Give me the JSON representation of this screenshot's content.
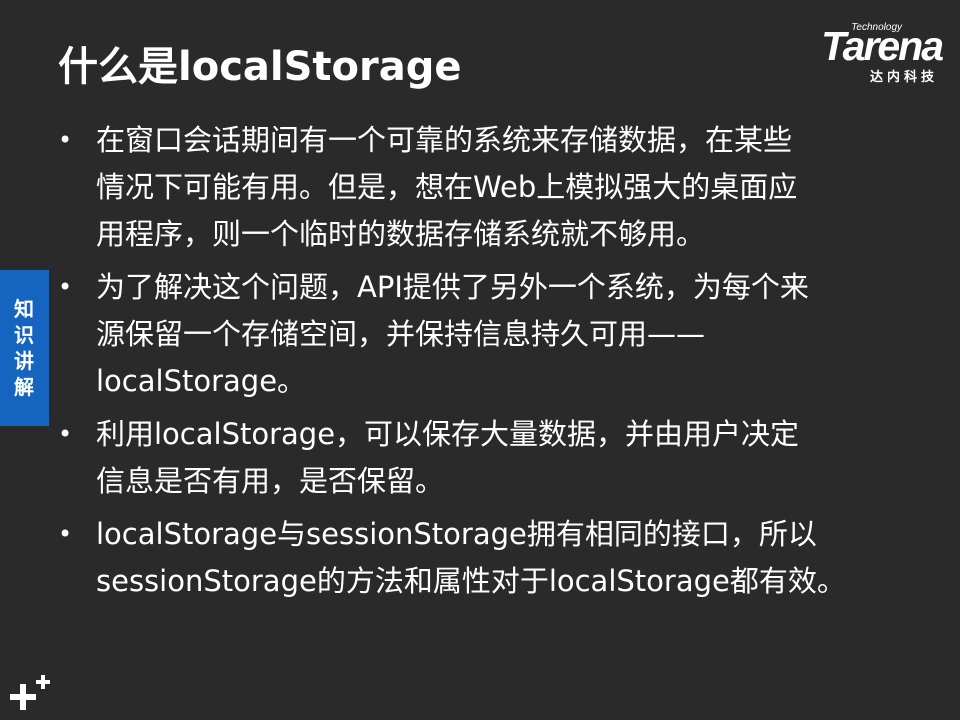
{
  "slide": {
    "title": "什么是localStorage",
    "logo": {
      "brand": "Tarena",
      "tagline": "Technology",
      "chinese": "达内科技"
    },
    "side_tab": {
      "label": "知识讲解"
    },
    "bullets": [
      {
        "lines": [
          "在窗口会话期间有一个可靠的系统来存储数据，在某些",
          "情况下可能有用。但是，想在Web上模拟强大的桌面应",
          "用程序，则一个临时的数据存储系统就不够用。"
        ]
      },
      {
        "lines": [
          "为了解决这个问题，API提供了另外一个系统，为每个来",
          "源保留一个存储空间，并保持信息持久可用——",
          "localStorage。"
        ]
      },
      {
        "lines": [
          "利用localStorage，可以保存大量数据，并由用户决定",
          "信息是否有用，是否保留。"
        ]
      },
      {
        "lines": [
          "localStorage与sessionStorage拥有相同的接口，所以",
          "sessionStorage的方法和属性对于localStorage都有效。"
        ]
      }
    ],
    "bullet_symbol": "•"
  }
}
